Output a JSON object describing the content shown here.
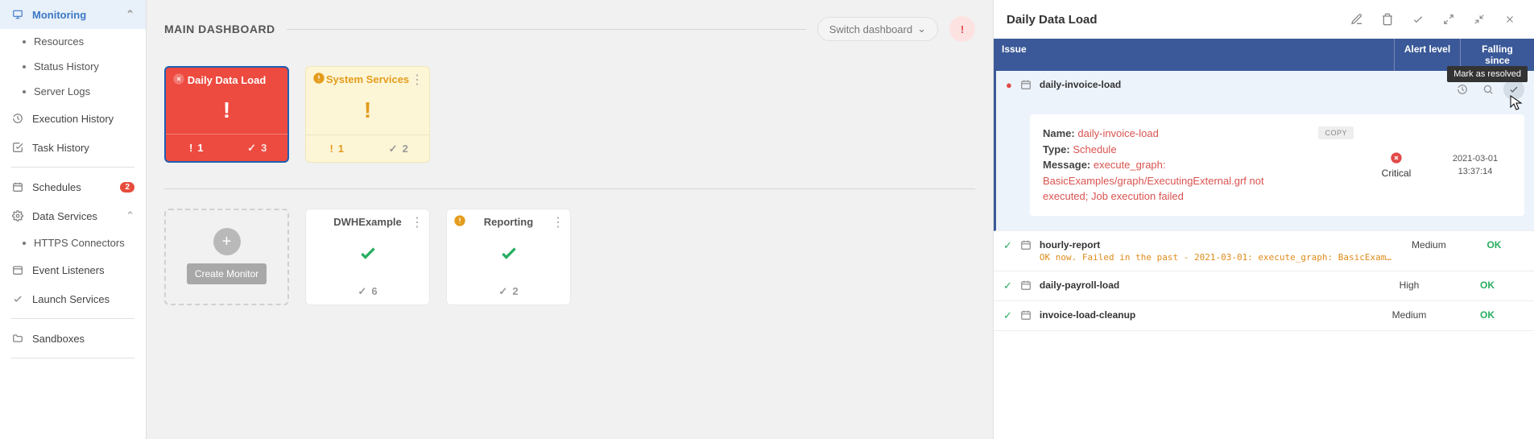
{
  "sidebar": {
    "monitoring": {
      "label": "Monitoring",
      "subs": [
        "Resources",
        "Status History",
        "Server Logs"
      ]
    },
    "executionHistory": "Execution History",
    "taskHistory": "Task History",
    "schedules": {
      "label": "Schedules",
      "badge": "2"
    },
    "dataServices": {
      "label": "Data Services",
      "subs": [
        "HTTPS Connectors"
      ]
    },
    "eventListeners": "Event Listeners",
    "launchServices": "Launch Services",
    "sandboxes": "Sandboxes"
  },
  "main": {
    "title": "MAIN DASHBOARD",
    "switch": "Switch dashboard",
    "cards": {
      "daily": {
        "title": "Daily Data Load",
        "err": "1",
        "ok": "3"
      },
      "system": {
        "title": "System Services",
        "warn": "1",
        "ok": "2"
      },
      "dwh": {
        "title": "DWHExample",
        "ok": "6"
      },
      "reporting": {
        "title": "Reporting",
        "ok": "2"
      },
      "createLabel": "Create Monitor"
    }
  },
  "detail": {
    "title": "Daily Data Load",
    "headers": {
      "issue": "Issue",
      "level": "Alert level",
      "since": "Falling since"
    },
    "tooltip": "Mark as resolved",
    "expanded": {
      "name": "daily-invoice-load",
      "copy": "COPY",
      "k1": "Name:",
      "v1": "daily-invoice-load",
      "k2": "Type:",
      "v2": "Schedule",
      "k3": "Message:",
      "v3": "execute_graph: BasicExamples/graph/ExecutingExternal.grf not executed; Job execution failed",
      "level": "Critical",
      "ts1": "2021-03-01",
      "ts2": "13:37:14"
    },
    "rows": [
      {
        "name": "hourly-report",
        "sub": "OK now. Failed in the past - 2021-03-01: execute_graph: BasicExampl…",
        "level": "Medium",
        "ok": "OK"
      },
      {
        "name": "daily-payroll-load",
        "level": "High",
        "ok": "OK"
      },
      {
        "name": "invoice-load-cleanup",
        "level": "Medium",
        "ok": "OK"
      }
    ]
  }
}
